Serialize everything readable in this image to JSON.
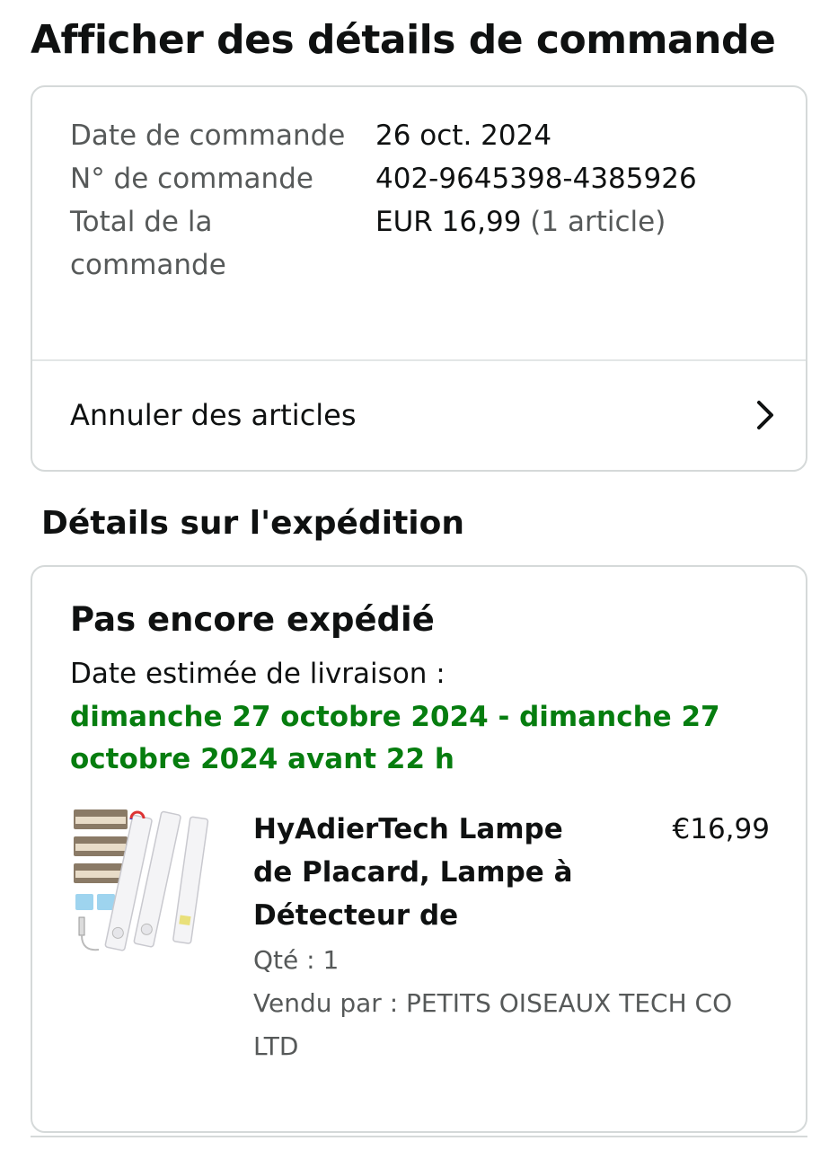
{
  "page": {
    "title": "Afficher des détails de commande"
  },
  "summary": {
    "order_date_label": "Date de commande",
    "order_date_value": "26 oct. 2024",
    "order_number_label": "N° de commande",
    "order_number_value": "402-9645398-4385926",
    "total_label": "Total de la commande",
    "total_value": "EUR 16,99",
    "total_count": "(1 article)",
    "cancel_label": "Annuler des articles"
  },
  "shipping": {
    "section_title": "Détails sur l'expédition",
    "status": "Pas encore expédié",
    "eta_label": "Date estimée de livraison :",
    "eta_value": "dimanche 27 octobre 2024 - dimanche 27 octobre 2024 avant 22 h"
  },
  "item": {
    "name": "HyAdierTech Lampe de Placard, Lampe à Détecteur de",
    "price": "€16,99",
    "qty": "Qté : 1",
    "seller": "Vendu par : PETITS OISEAUX TECH CO LTD"
  },
  "colors": {
    "text": "#0f1111",
    "muted": "#565959",
    "success_green": "#067d0f",
    "border": "#d5d9d9"
  },
  "icons": {
    "cancel_row": "chevron-right-icon"
  }
}
